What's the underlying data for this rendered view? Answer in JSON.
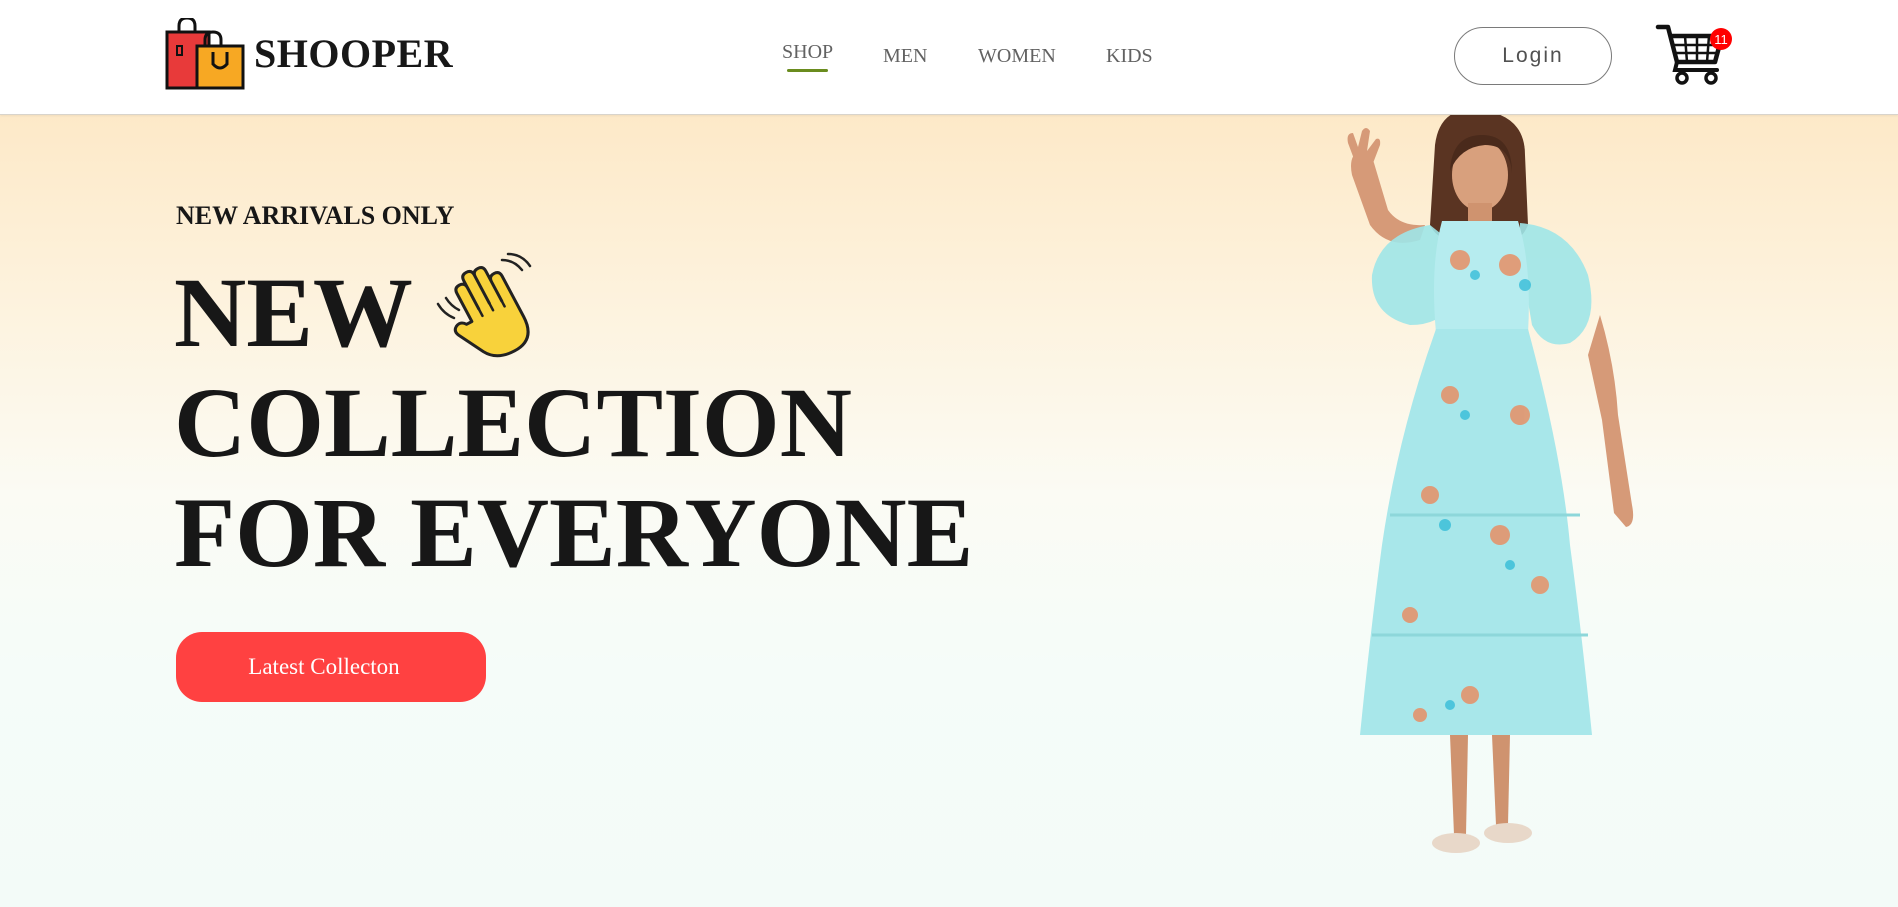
{
  "header": {
    "brand": "SHOOPER",
    "nav": [
      {
        "label": "SHOP",
        "active": true
      },
      {
        "label": "MEN"
      },
      {
        "label": "WOMEN"
      },
      {
        "label": "KIDS"
      }
    ],
    "login_label": "Login",
    "cart_count": "11",
    "icons": {
      "logo": "shopping-bags-icon",
      "cart": "shopping-cart-icon"
    }
  },
  "hero": {
    "eyebrow": "NEW ARRIVALS ONLY",
    "headline_line1": "NEW",
    "headline_line2": "COLLECTION",
    "headline_line3": "FOR EVERYONE",
    "wave_icon": "waving-hand-icon",
    "cta_label": "Latest Collecton",
    "image": "model-in-floral-dress"
  },
  "colors": {
    "accent": "#ff4141",
    "nav_active_underline": "#6a8c1e",
    "badge": "#ff0000",
    "text_dark": "#171717"
  }
}
